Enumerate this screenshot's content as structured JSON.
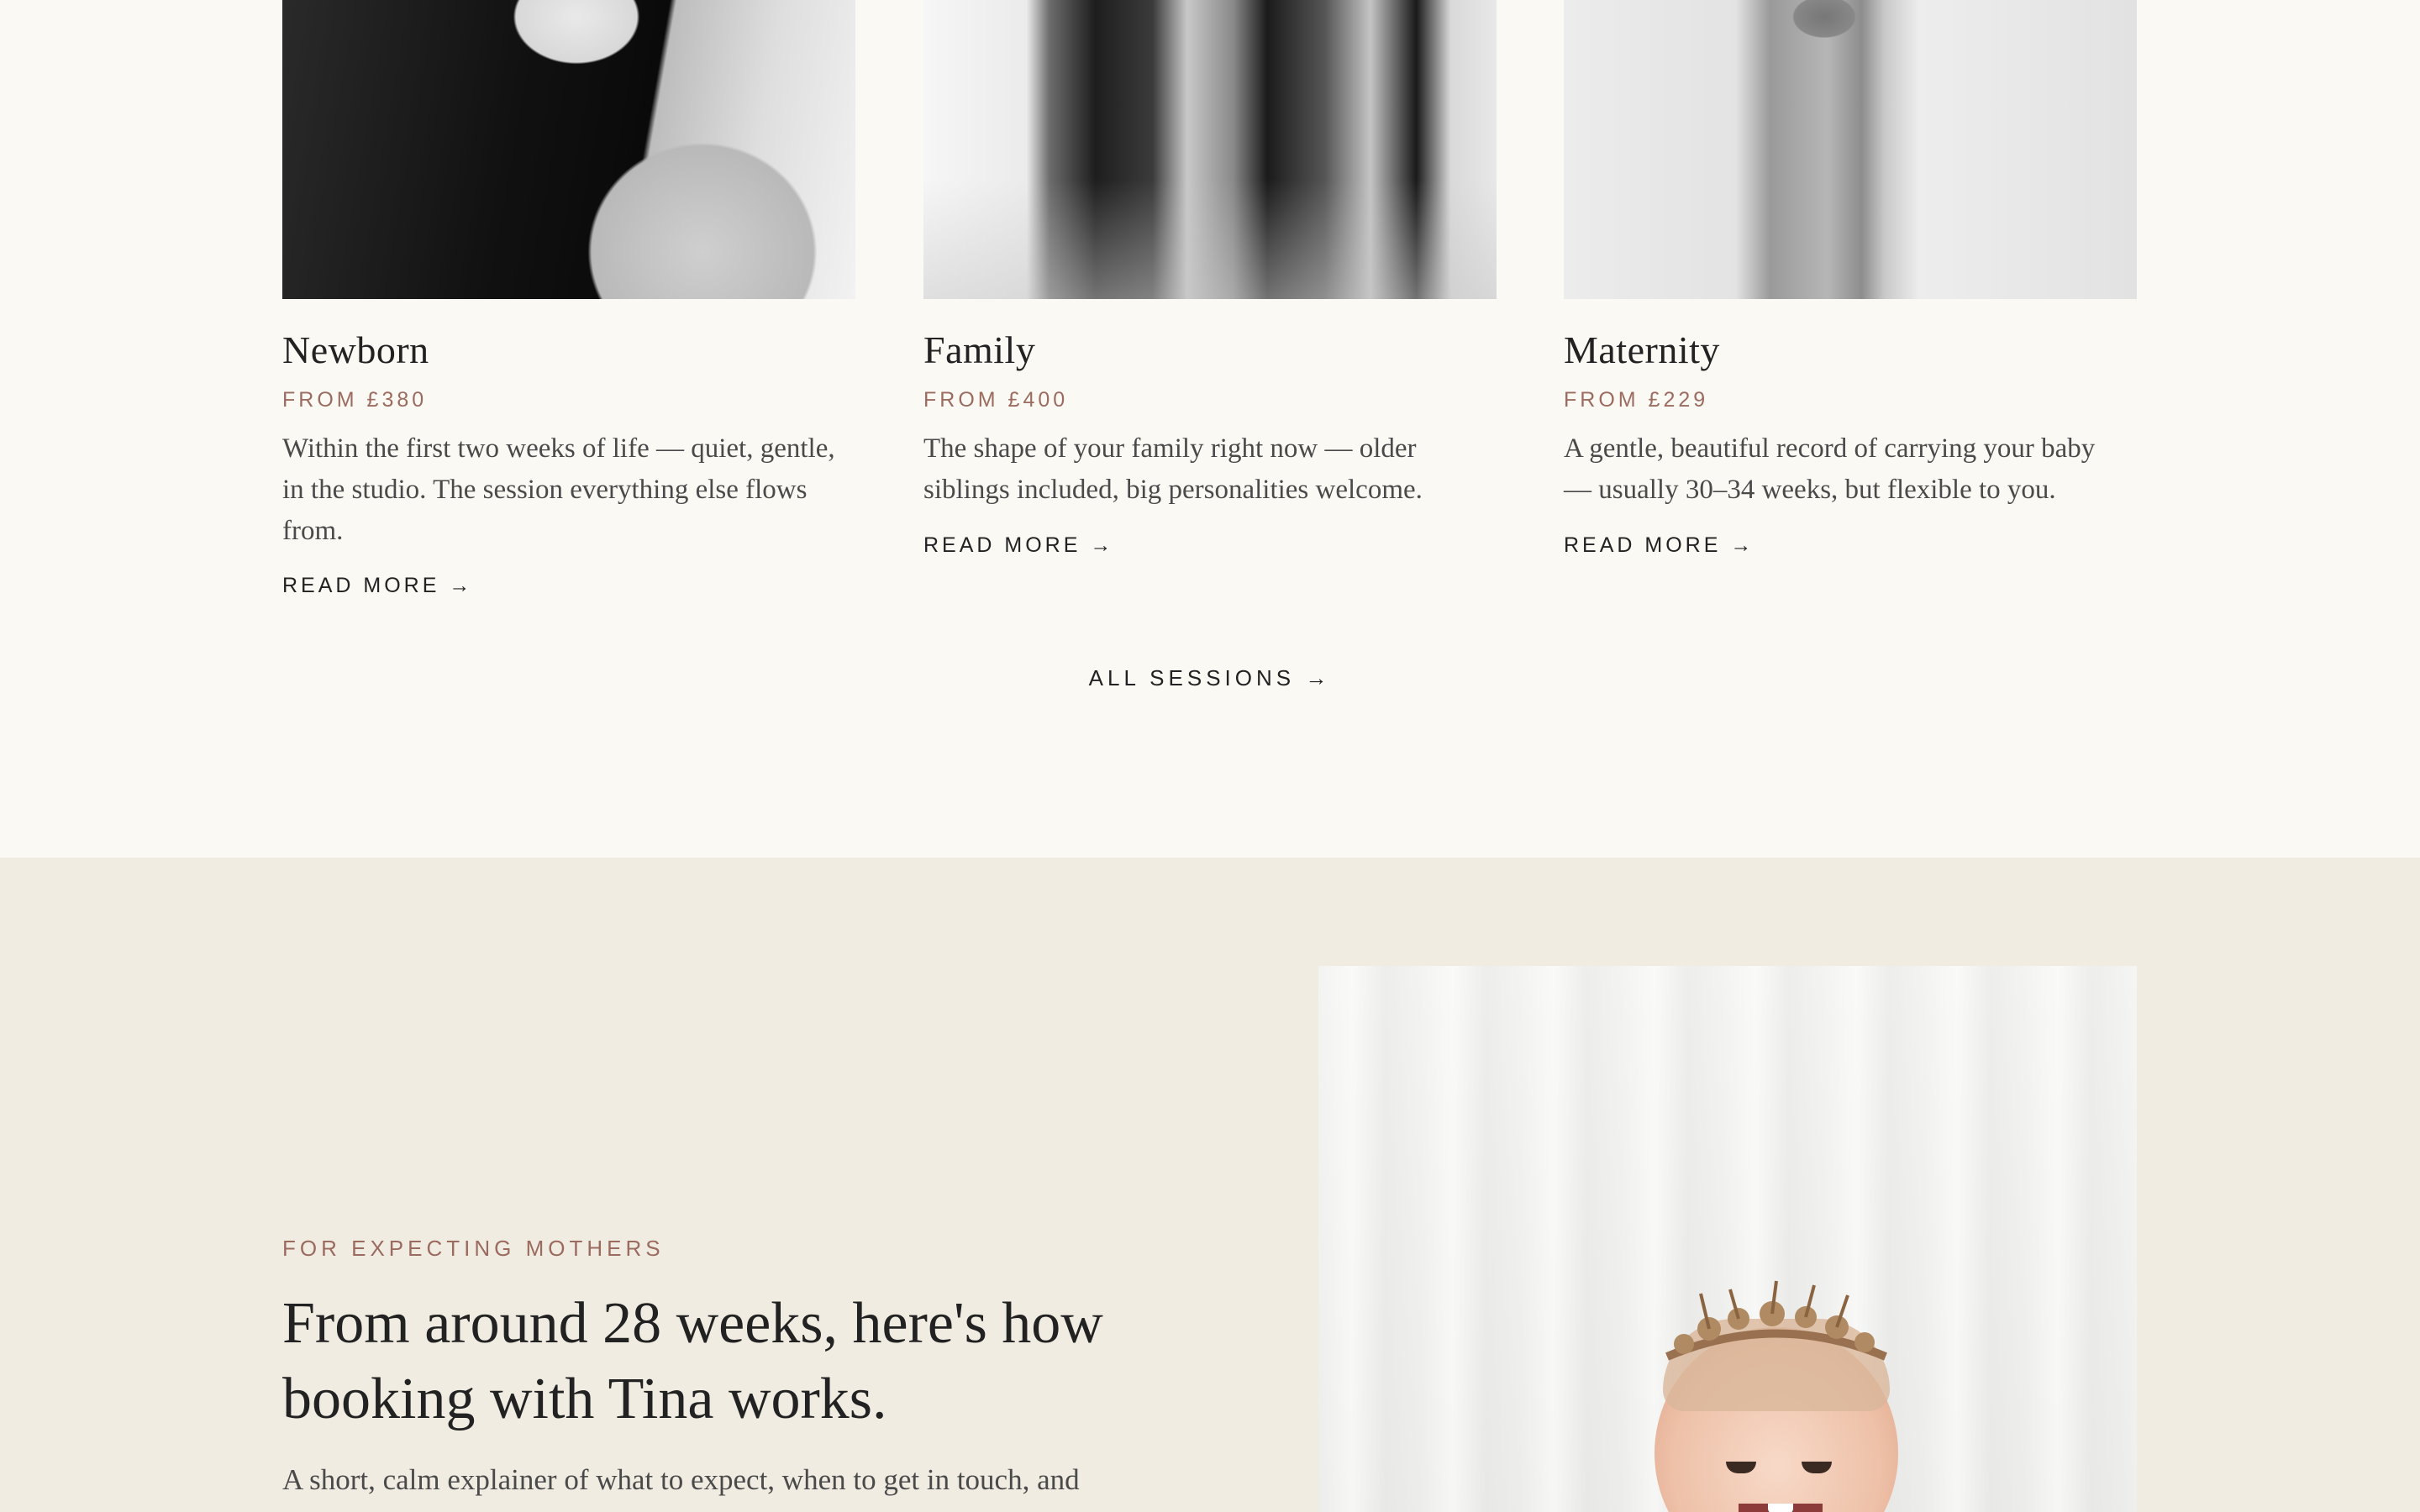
{
  "sessions": {
    "cards": [
      {
        "title": "Newborn",
        "price": "FROM £380",
        "description": "Within the first two weeks of life — quiet, gentle, in the studio. The session everything else flows from.",
        "link": "READ MORE →",
        "image": "newborn-photo"
      },
      {
        "title": "Family",
        "price": "FROM £400",
        "description": "The shape of your family right now — older siblings included, big personalities welcome.",
        "link": "READ MORE →",
        "image": "family-photo"
      },
      {
        "title": "Maternity",
        "price": "FROM £229",
        "description": "A gentle, beautiful record of carrying your baby — usually 30–34 weeks, but flexible to you.",
        "link": "READ MORE →",
        "image": "maternity-photo"
      }
    ],
    "all_sessions_link": "ALL SESSIONS →"
  },
  "expecting": {
    "eyebrow": "FOR EXPECTING MOTHERS",
    "headline": "From around 28 weeks, here's how booking with Tina works.",
    "intro": "A short, calm explainer of what to expect, when to get in touch, and",
    "image": "smiling-baby-photo"
  },
  "colors": {
    "page_bg": "#fbf9f4",
    "section_bg": "#f1ece2",
    "accent": "#9c6b60",
    "text": "#222222"
  }
}
